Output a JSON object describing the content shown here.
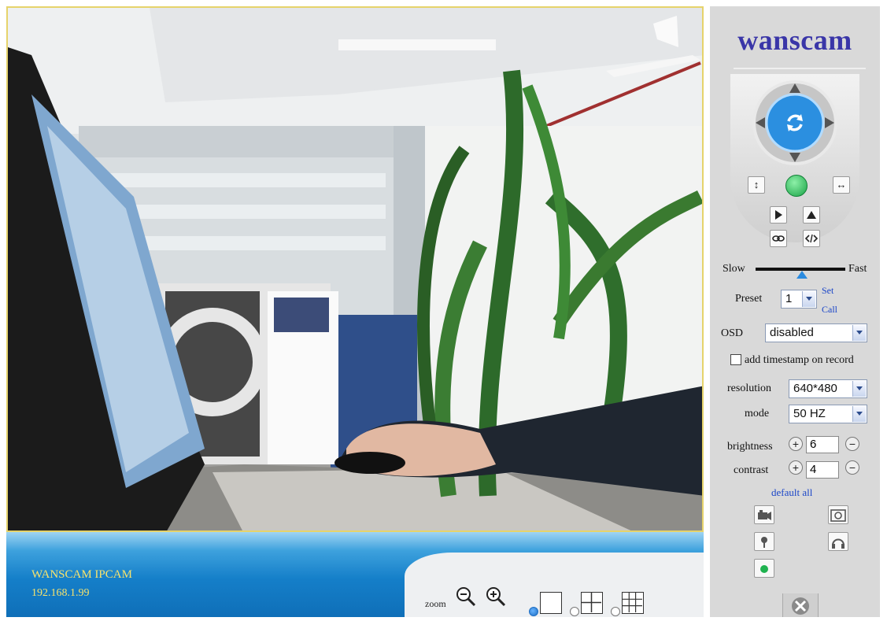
{
  "camera": {
    "name": "WANSCAM IPCAM",
    "ip": "192.168.1.99"
  },
  "toolbar": {
    "zoom_label": "zoom",
    "selected_layout": "1x1"
  },
  "panel": {
    "logo": "wanscam",
    "speed": {
      "slow_label": "Slow",
      "fast_label": "Fast"
    },
    "preset": {
      "label": "Preset",
      "value": "1",
      "set_label": "Set",
      "call_label": "Call"
    },
    "osd": {
      "label": "OSD",
      "value": "disabled"
    },
    "timestamp": {
      "label": "add timestamp on record",
      "checked": false
    },
    "resolution": {
      "label": "resolution",
      "value": "640*480"
    },
    "mode": {
      "label": "mode",
      "value": "50 HZ"
    },
    "brightness": {
      "label": "brightness",
      "value": "6"
    },
    "contrast": {
      "label": "contrast",
      "value": "4"
    },
    "default_all": "default all"
  },
  "colors": {
    "accent_blue": "#157fc9",
    "cam_text": "#f7e36d",
    "logo": "#3a36a8",
    "panel_bg": "#d9d9d9"
  }
}
